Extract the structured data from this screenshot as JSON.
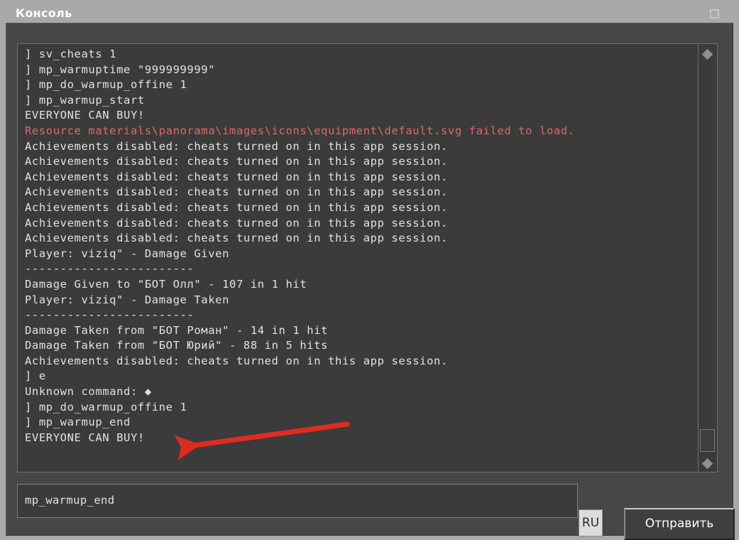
{
  "window": {
    "title": "Консоль",
    "maximize_icon": "maximize-icon"
  },
  "console": {
    "lines": [
      {
        "text": "] sv_cheats 1",
        "color": "normal"
      },
      {
        "text": "] mp_warmuptime \"999999999\"",
        "color": "normal"
      },
      {
        "text": "] mp_do_warmup_offine 1",
        "color": "normal"
      },
      {
        "text": "] mp_warmup_start",
        "color": "normal"
      },
      {
        "text": "EVERYONE CAN BUY!",
        "color": "normal"
      },
      {
        "text": "Resource materials\\panorama\\images\\icons\\equipment\\default.svg failed to load.",
        "color": "error"
      },
      {
        "text": "Achievements disabled: cheats turned on in this app session.",
        "color": "normal"
      },
      {
        "text": "Achievements disabled: cheats turned on in this app session.",
        "color": "normal"
      },
      {
        "text": "Achievements disabled: cheats turned on in this app session.",
        "color": "normal"
      },
      {
        "text": "Achievements disabled: cheats turned on in this app session.",
        "color": "normal"
      },
      {
        "text": "Achievements disabled: cheats turned on in this app session.",
        "color": "normal"
      },
      {
        "text": "Achievements disabled: cheats turned on in this app session.",
        "color": "normal"
      },
      {
        "text": "Achievements disabled: cheats turned on in this app session.",
        "color": "normal"
      },
      {
        "text": "Player: viziq\" - Damage Given",
        "color": "normal"
      },
      {
        "text": "------------------------",
        "color": "normal"
      },
      {
        "text": "Damage Given to \"БОТ Олл\" - 107 in 1 hit",
        "color": "normal"
      },
      {
        "text": "Player: viziq\" - Damage Taken",
        "color": "normal"
      },
      {
        "text": "------------------------",
        "color": "normal"
      },
      {
        "text": "Damage Taken from \"БОТ Роман\" - 14 in 1 hit",
        "color": "normal"
      },
      {
        "text": "Damage Taken from \"БОТ Юрий\" - 88 in 5 hits",
        "color": "normal"
      },
      {
        "text": "Achievements disabled: cheats turned on in this app session.",
        "color": "normal"
      },
      {
        "text": "] е",
        "color": "normal"
      },
      {
        "text": "Unknown command: ◆",
        "color": "normal"
      },
      {
        "text": "] mp_do_warmup_offine 1",
        "color": "normal"
      },
      {
        "text": "] mp_warmup_end",
        "color": "normal"
      },
      {
        "text": "EVERYONE CAN BUY!",
        "color": "normal"
      }
    ],
    "text_color": "#e2e2e2",
    "error_color": "#e06767",
    "background_color": "#3b3b3b"
  },
  "scrollbar": {
    "up_arrow_icon": "scroll-up-diamond-icon",
    "down_arrow_icon": "scroll-down-diamond-icon"
  },
  "annotation": {
    "arrow_color": "#e02b20",
    "arrow_icon": "red-arrow-annotation"
  },
  "input_bar": {
    "command_value": "mp_warmup_end",
    "command_placeholder": "",
    "language_badge": "RU",
    "send_label": "Отправить"
  }
}
